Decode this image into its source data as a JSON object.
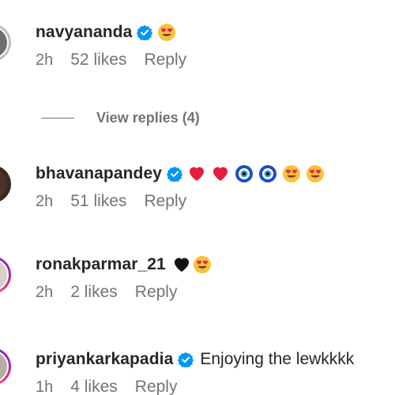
{
  "comments": [
    {
      "username": "navyananda",
      "verified": true,
      "text": "",
      "emojis": [
        "heart-eyes-emoji"
      ],
      "time": "2h",
      "likes": "52 likes",
      "reply": "Reply"
    },
    {
      "username": "bhavanapandey",
      "verified": true,
      "text": "",
      "emojis": [
        "red-heart-emoji",
        "red-heart-emoji",
        "nazar-amulet-emoji",
        "nazar-amulet-emoji",
        "heart-eyes-emoji",
        "heart-eyes-emoji"
      ],
      "time": "2h",
      "likes": "51 likes",
      "reply": "Reply"
    },
    {
      "username": "ronakparmar_21",
      "verified": false,
      "text": "",
      "emojis": [
        "black-heart-emoji",
        "heart-eyes-emoji"
      ],
      "time": "2h",
      "likes": "2 likes",
      "reply": "Reply"
    },
    {
      "username": "priyankarkapadia",
      "verified": true,
      "text": "Enjoying the lewkkkk",
      "emojis": [],
      "time": "1h",
      "likes": "4 likes",
      "reply": "Reply"
    }
  ],
  "view_replies": {
    "label": "View replies (4)"
  },
  "colors": {
    "verified_blue": "#0095f6",
    "meta_gray": "#737373",
    "text_dark": "#262626"
  }
}
